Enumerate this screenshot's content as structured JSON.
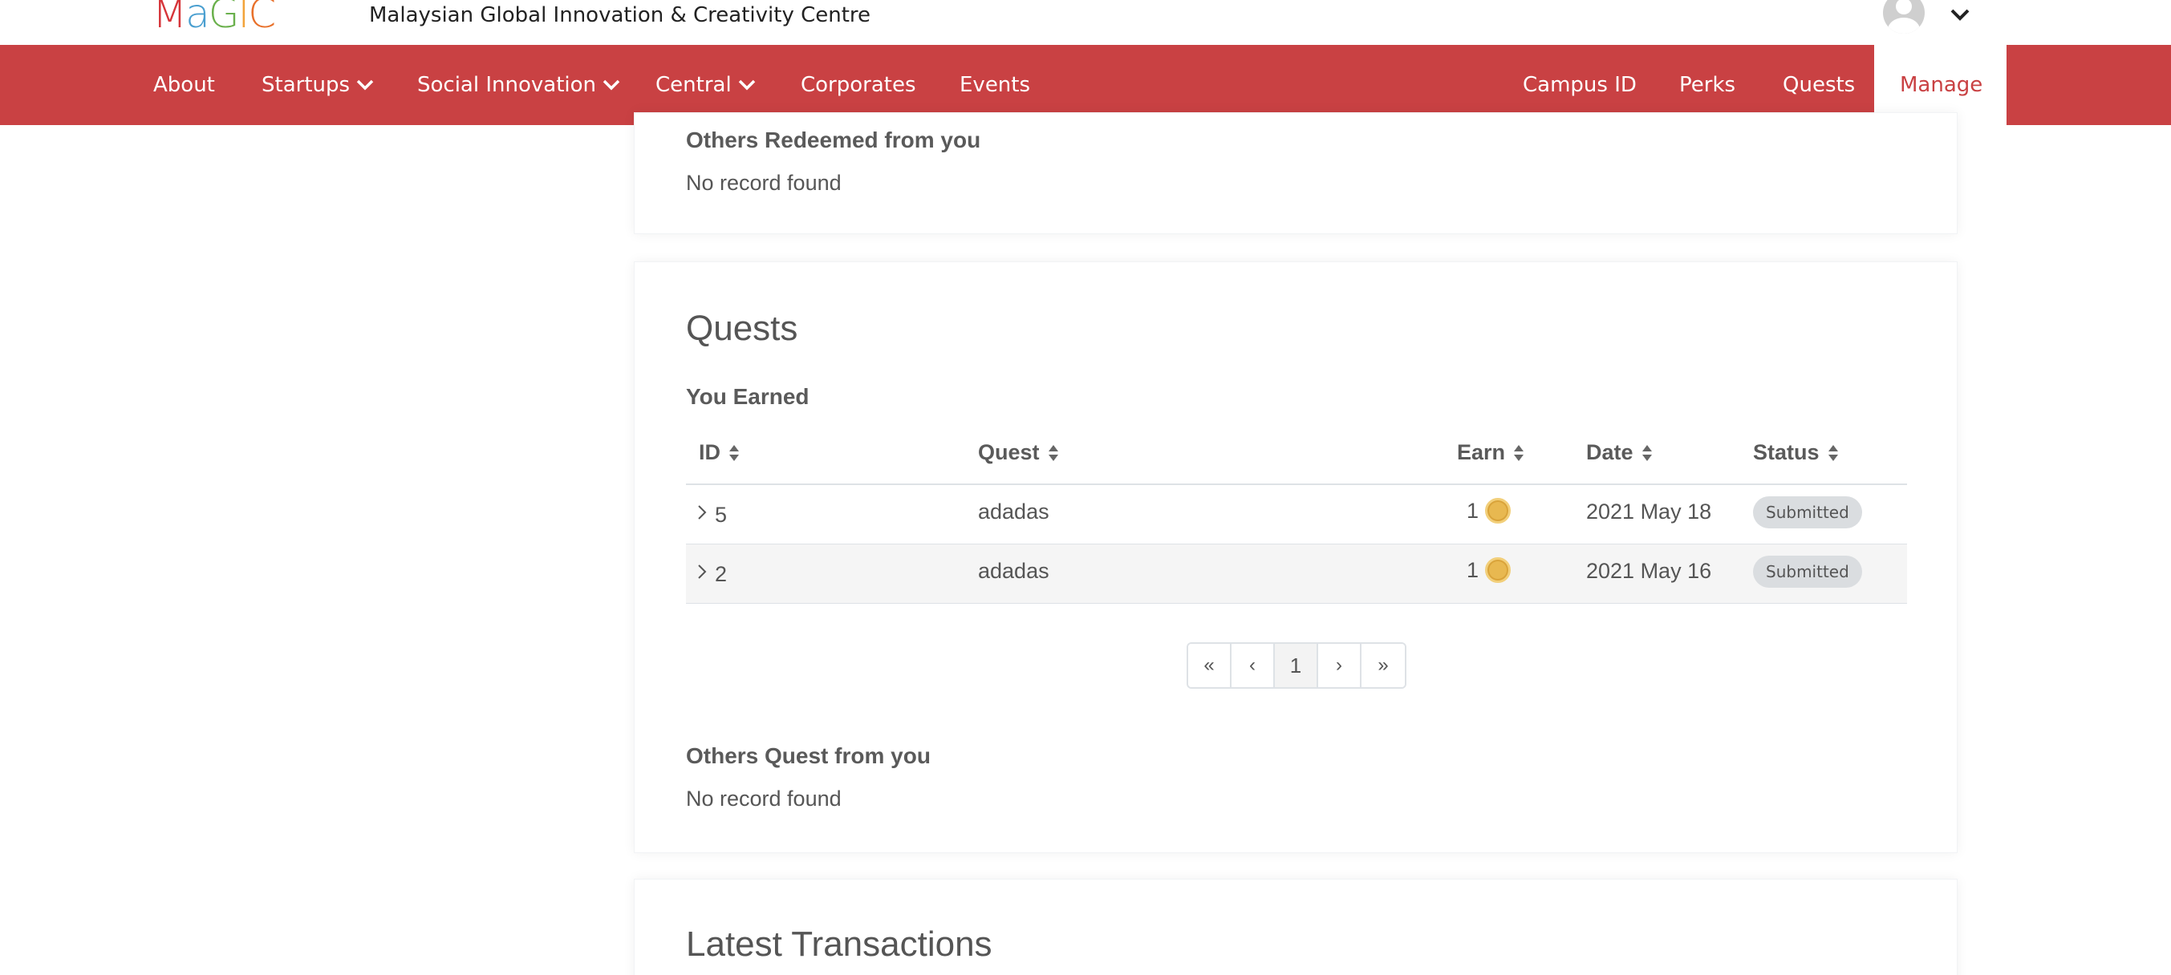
{
  "brand": {
    "logo_text": "MaGIC",
    "site_name": "Malaysian Global Innovation & Creativity Centre"
  },
  "nav": {
    "left": [
      {
        "label": "About"
      },
      {
        "label": "Startups"
      },
      {
        "label": "Social Innovation"
      },
      {
        "label": "Central"
      },
      {
        "label": "Corporates"
      },
      {
        "label": "Events"
      }
    ],
    "right": [
      {
        "label": "Campus ID"
      },
      {
        "label": "Perks"
      },
      {
        "label": "Quests"
      },
      {
        "label": "Manage"
      }
    ]
  },
  "redeemed": {
    "heading": "Others Redeemed from you",
    "empty": "No record found"
  },
  "quests": {
    "title": "Quests",
    "earned_heading": "You Earned",
    "columns": [
      "ID",
      "Quest",
      "Earn",
      "Date",
      "Status"
    ],
    "rows": [
      {
        "id": "5",
        "quest": "adadas",
        "earn": "1",
        "date": "2021 May 18",
        "status": "Submitted"
      },
      {
        "id": "2",
        "quest": "adadas",
        "earn": "1",
        "date": "2021 May 16",
        "status": "Submitted"
      }
    ],
    "pagination": {
      "first": "«",
      "prev": "‹",
      "current": "1",
      "next": "›",
      "last": "»"
    },
    "others_heading": "Others Quest from you",
    "others_empty": "No record found"
  },
  "transactions": {
    "title": "Latest Transactions"
  },
  "colors": {
    "brand_red": "#c94143",
    "coin": "#e8b850",
    "badge": "#dadde0"
  },
  "icons": [
    "magic-logo",
    "avatar-icon",
    "chevron-down-icon",
    "sort-icon",
    "chevron-right-icon",
    "coin-icon"
  ]
}
